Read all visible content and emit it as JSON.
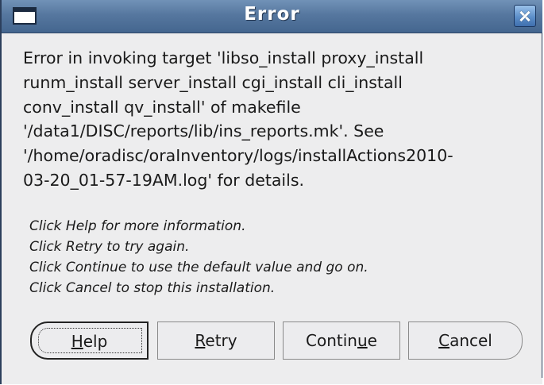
{
  "window": {
    "title": "Error"
  },
  "message": {
    "lines": [
      "Error in invoking target 'libso_install proxy_install",
      "runm_install server_install cgi_install cli_install",
      "conv_install qv_install' of makefile",
      "'/data1/DISC/reports/lib/ins_reports.mk'. See",
      "'/home/oradisc/oraInventory/logs/installActions2010-",
      "03-20_01-57-19AM.log' for details."
    ]
  },
  "hints": {
    "lines": [
      "Click Help for more information.",
      "Click Retry to try again.",
      "Click Continue to use the default value and go on.",
      "Click Cancel to stop this installation."
    ]
  },
  "buttons": {
    "help": {
      "mnemonic": "H",
      "rest": "elp"
    },
    "retry": {
      "mnemonic": "R",
      "rest": "etry"
    },
    "continue": {
      "pre": "Contin",
      "mnemonic": "u",
      "post": "e"
    },
    "cancel": {
      "mnemonic": "C",
      "rest": "ancel"
    }
  },
  "icons": {
    "window_icon": "window-icon",
    "close": "close-icon"
  }
}
